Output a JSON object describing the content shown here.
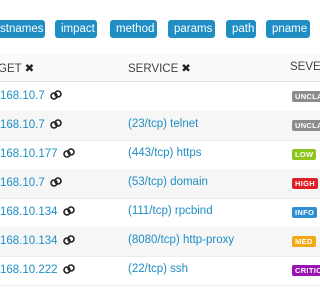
{
  "filter_tags": [
    "stnames",
    "impact",
    "method",
    "params",
    "path",
    "pname"
  ],
  "columns": {
    "target": "GET",
    "service": "SERVICE",
    "severity": "SEVER"
  },
  "rows": [
    {
      "ip": "168.10.7",
      "service": "",
      "severity": "UNCLA",
      "sev_color": "#8c8c8c"
    },
    {
      "ip": "168.10.7",
      "service": "(23/tcp) telnet",
      "severity": "UNCLA",
      "sev_color": "#8c8c8c"
    },
    {
      "ip": "168.10.177",
      "service": "(443/tcp) https",
      "severity": "LOW",
      "sev_color": "#8ec41c"
    },
    {
      "ip": "168.10.7",
      "service": "(53/tcp) domain",
      "severity": "HIGH",
      "sev_color": "#dd1f26"
    },
    {
      "ip": "168.10.134",
      "service": "(111/tcp) rpcbind",
      "severity": "INFO",
      "sev_color": "#2f8fd0"
    },
    {
      "ip": "168.10.134",
      "service": "(8080/tcp) http-proxy",
      "severity": "MED",
      "sev_color": "#f2a916"
    },
    {
      "ip": "168.10.222",
      "service": "(22/tcp) ssh",
      "severity": "CRITIC",
      "sev_color": "#9b12b5"
    }
  ],
  "icons": {
    "remove": "close-icon",
    "link": "link-chain-icon"
  }
}
